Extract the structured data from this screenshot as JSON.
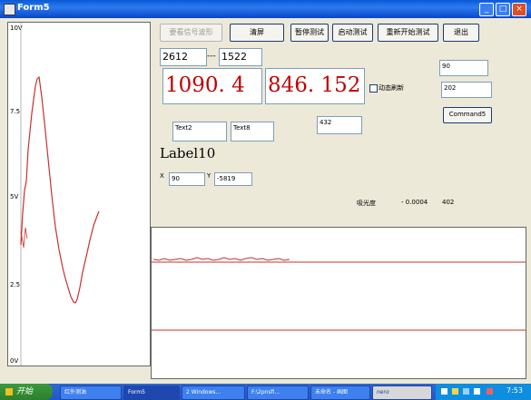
{
  "window": {
    "title": "Form5"
  },
  "titlebar_buttons": {
    "minimize": "_",
    "maximize": "□",
    "close": "×"
  },
  "left_plot": {
    "y_ticks": [
      "10V",
      "7.5",
      "5V",
      "2.5",
      "0V"
    ],
    "series_color": "#c83030"
  },
  "buttons": {
    "view_waveform": "要看信号波形",
    "clear_screen": "清屏",
    "pause_test": "暂停测试",
    "start_test": "启动测试",
    "restart_test": "重新开始测试",
    "exit": "退出",
    "command5": "Command5"
  },
  "fields": {
    "left_value": "2612",
    "separator": "---",
    "right_value": "1522",
    "big_value_1": "1090. 4",
    "big_value_2": "846. 152",
    "right_top": "90",
    "right_mid": "202",
    "text2": "Text2",
    "text8": "Text8",
    "mid_value": "432",
    "x_label": "X",
    "x_value": "90",
    "y_label": "Y",
    "y_value": "-5819"
  },
  "checkbox": {
    "label": "动态刷新",
    "checked": false
  },
  "label10": "Label10",
  "absorbance": {
    "label": "吸光度",
    "value": "- 0.0004",
    "count": "402"
  },
  "taskbar": {
    "start": "开始",
    "items": [
      "红外测油",
      "Form5",
      "2 Windows...",
      "F:\\2pnsfi...",
      "未命名 - 画图",
      "nero"
    ],
    "clock": "7:53"
  },
  "colors": {
    "accent_red": "#c00000",
    "line_red": "#c83030"
  }
}
